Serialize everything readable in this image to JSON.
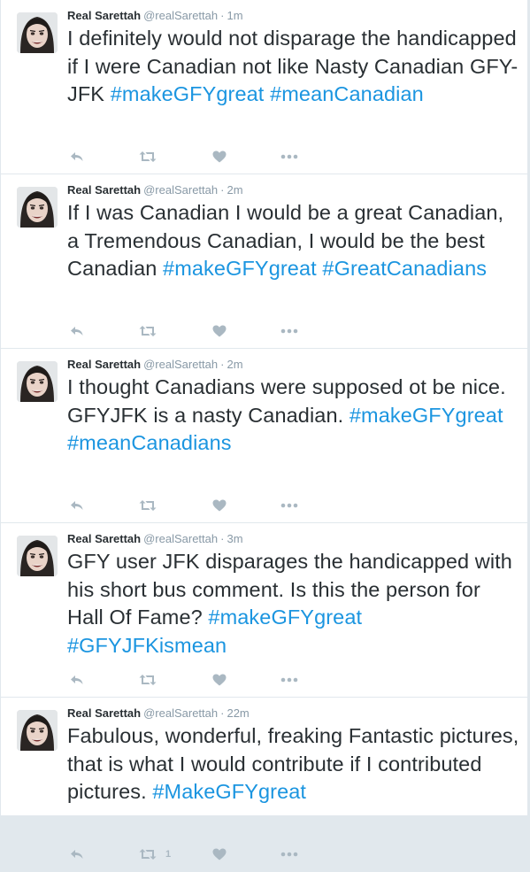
{
  "colors": {
    "hashtag": "#1b95e0",
    "text": "#292f33",
    "meta": "#8899a6",
    "action_icon": "#aab8c2",
    "divider": "#e1e8ed"
  },
  "icons": {
    "reply": "reply-icon",
    "retweet": "retweet-icon",
    "like": "heart-icon",
    "more": "more-dots-icon"
  },
  "tweets": [
    {
      "fullname": "Real Sarettah",
      "username": "@realSarettah",
      "separator": "·",
      "time": "1m",
      "segments": [
        {
          "text": "I definitely would not disparage the handicapped if I were Canadian not like Nasty Canadian GFY-JFK ",
          "type": "text"
        },
        {
          "text": "#makeGFYgreat",
          "type": "hashtag"
        },
        {
          "text": " ",
          "type": "text"
        },
        {
          "text": "#meanCanadian",
          "type": "hashtag"
        }
      ],
      "retweet_count": ""
    },
    {
      "fullname": "Real Sarettah",
      "username": "@realSarettah",
      "separator": "·",
      "time": "2m",
      "segments": [
        {
          "text": "If I was Canadian I would be a great Canadian, a Tremendous Canadian, I would be the best Canadian ",
          "type": "text"
        },
        {
          "text": "#makeGFYgreat",
          "type": "hashtag"
        },
        {
          "text": " ",
          "type": "text"
        },
        {
          "text": "#GreatCanadians",
          "type": "hashtag"
        }
      ],
      "retweet_count": ""
    },
    {
      "fullname": "Real Sarettah",
      "username": "@realSarettah",
      "separator": "·",
      "time": "2m",
      "segments": [
        {
          "text": "I thought Canadians were supposed ot be nice. GFYJFK is a nasty Canadian. ",
          "type": "text"
        },
        {
          "text": "#makeGFYgreat",
          "type": "hashtag"
        },
        {
          "text": " ",
          "type": "text"
        },
        {
          "text": "#meanCanadians",
          "type": "hashtag"
        }
      ],
      "retweet_count": ""
    },
    {
      "fullname": "Real Sarettah",
      "username": "@realSarettah",
      "separator": "·",
      "time": "3m",
      "segments": [
        {
          "text": "GFY user JFK disparages the handicapped with his short bus comment. Is this the person for Hall Of Fame? ",
          "type": "text"
        },
        {
          "text": "#makeGFYgreat",
          "type": "hashtag"
        },
        {
          "text": " ",
          "type": "text"
        },
        {
          "text": "#GFYJFKismean",
          "type": "hashtag"
        }
      ],
      "retweet_count": ""
    },
    {
      "fullname": "Real Sarettah",
      "username": "@realSarettah",
      "separator": "·",
      "time": "22m",
      "segments": [
        {
          "text": "Fabulous, wonderful, freaking Fantastic pictures, that is what I would contribute if I contributed pictures.  ",
          "type": "text"
        },
        {
          "text": "#MakeGFYgreat",
          "type": "hashtag"
        }
      ],
      "retweet_count": "1"
    }
  ]
}
